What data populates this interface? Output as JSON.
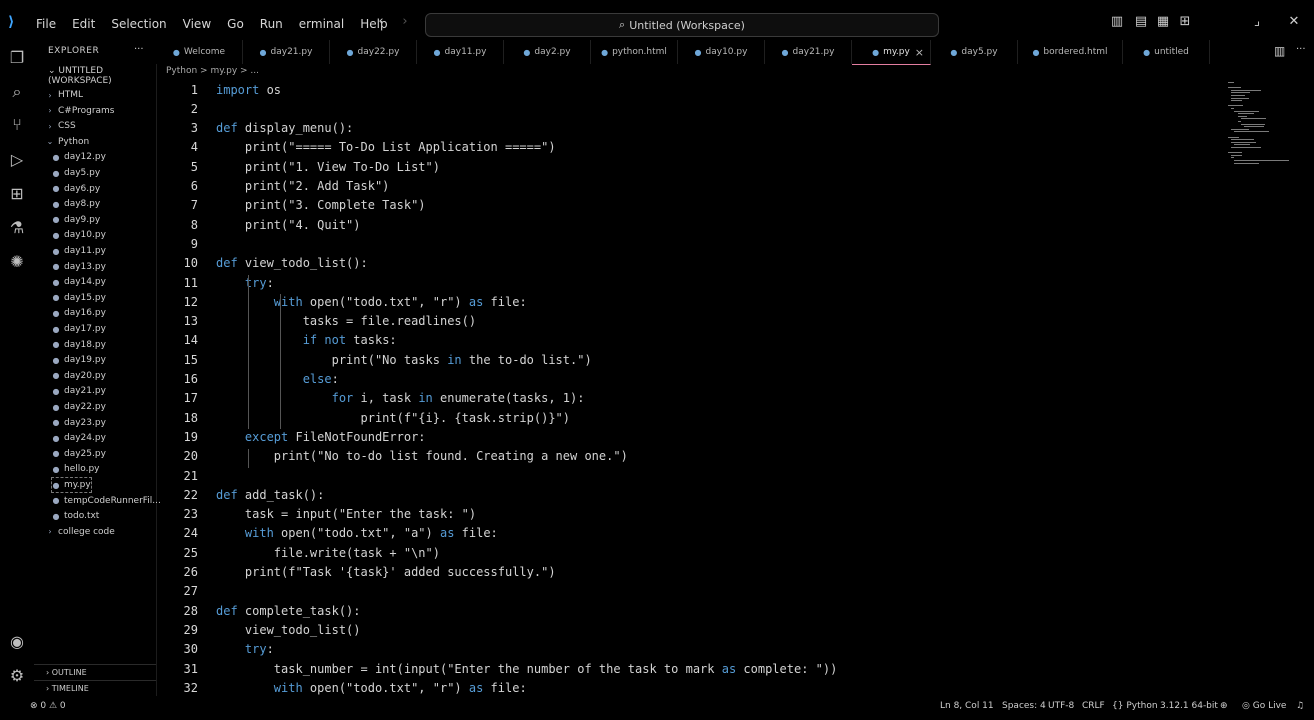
{
  "menu": [
    "File",
    "Edit",
    "Selection",
    "View",
    "Go",
    "Run",
    "erminal",
    "Help"
  ],
  "search": "Untitled (Workspace)",
  "explorer": {
    "title": "EXPLORER",
    "workspace": "UNTITLED (WORKSPACE)",
    "tree": [
      {
        "label": "HTML",
        "type": "folder",
        "depth": 1
      },
      {
        "label": "C#Programs",
        "type": "folder",
        "depth": 1
      },
      {
        "label": "CSS",
        "type": "folder",
        "depth": 1
      },
      {
        "label": "Python",
        "type": "folder-open",
        "depth": 1
      },
      {
        "label": "day12.py",
        "type": "file",
        "depth": 2
      },
      {
        "label": "day5.py",
        "type": "file",
        "depth": 2
      },
      {
        "label": "day6.py",
        "type": "file",
        "depth": 2
      },
      {
        "label": "day8.py",
        "type": "file",
        "depth": 2
      },
      {
        "label": "day9.py",
        "type": "file",
        "depth": 2
      },
      {
        "label": "day10.py",
        "type": "file",
        "depth": 2
      },
      {
        "label": "day11.py",
        "type": "file",
        "depth": 2
      },
      {
        "label": "day13.py",
        "type": "file",
        "depth": 2
      },
      {
        "label": "day14.py",
        "type": "file",
        "depth": 2
      },
      {
        "label": "day15.py",
        "type": "file",
        "depth": 2
      },
      {
        "label": "day16.py",
        "type": "file",
        "depth": 2
      },
      {
        "label": "day17.py",
        "type": "file",
        "depth": 2
      },
      {
        "label": "day18.py",
        "type": "file",
        "depth": 2
      },
      {
        "label": "day19.py",
        "type": "file",
        "depth": 2
      },
      {
        "label": "day20.py",
        "type": "file",
        "depth": 2
      },
      {
        "label": "day21.py",
        "type": "file",
        "depth": 2
      },
      {
        "label": "day22.py",
        "type": "file",
        "depth": 2
      },
      {
        "label": "day23.py",
        "type": "file",
        "depth": 2
      },
      {
        "label": "day24.py",
        "type": "file",
        "depth": 2
      },
      {
        "label": "day25.py",
        "type": "file",
        "depth": 2
      },
      {
        "label": "hello.py",
        "type": "file",
        "depth": 2
      },
      {
        "label": "my.py",
        "type": "file",
        "depth": 2,
        "active": true
      },
      {
        "label": "tempCodeRunnerFil...",
        "type": "file",
        "depth": 2
      },
      {
        "label": "todo.txt",
        "type": "file",
        "depth": 2
      },
      {
        "label": "college code",
        "type": "folder",
        "depth": 1
      }
    ],
    "sections": [
      "OUTLINE",
      "TIMELINE"
    ]
  },
  "tabs": [
    {
      "label": "Welcome",
      "w": 0
    },
    {
      "label": "day21.py"
    },
    {
      "label": "day22.py"
    },
    {
      "label": "day11.py"
    },
    {
      "label": "day2.py"
    },
    {
      "label": "python.html"
    },
    {
      "label": "day10.py"
    },
    {
      "label": "day21.py"
    },
    {
      "label": "my.py",
      "active": true,
      "close": "×"
    },
    {
      "label": "day5.py"
    },
    {
      "label": "bordered.html"
    },
    {
      "label": "untitled"
    }
  ],
  "breadcrumb": "Python > my.py > ...",
  "code": [
    "import os",
    "",
    "def display_menu():",
    "    print(\"===== To-Do List Application =====\")",
    "    print(\"1. View To-Do List\")",
    "    print(\"2. Add Task\")",
    "    print(\"3. Complete Task\")",
    "    print(\"4. Quit\")",
    "",
    "def view_todo_list():",
    "    try:",
    "        with open(\"todo.txt\", \"r\") as file:",
    "            tasks = file.readlines()",
    "            if not tasks:",
    "                print(\"No tasks in the to-do list.\")",
    "            else:",
    "                for i, task in enumerate(tasks, 1):",
    "                    print(f\"{i}. {task.strip()}\")",
    "    except FileNotFoundError:",
    "        print(\"No to-do list found. Creating a new one.\")",
    "",
    "def add_task():",
    "    task = input(\"Enter the task: \")",
    "    with open(\"todo.txt\", \"a\") as file:",
    "        file.write(task + \"\\n\")",
    "    print(f\"Task '{task}' added successfully.\")",
    "",
    "def complete_task():",
    "    view_todo_list()",
    "    try:",
    "        task_number = int(input(\"Enter the number of the task to mark as complete: \"))",
    "        with open(\"todo.txt\", \"r\") as file:"
  ],
  "status": {
    "left": "⊗ 0 ⚠ 0",
    "position": "Ln 8, Col 11",
    "spaces": "Spaces: 4",
    "encoding": "UTF-8",
    "eol": "CRLF",
    "language": "Python",
    "version": "3.12.1 64-bit",
    "golive": "Go Live"
  }
}
